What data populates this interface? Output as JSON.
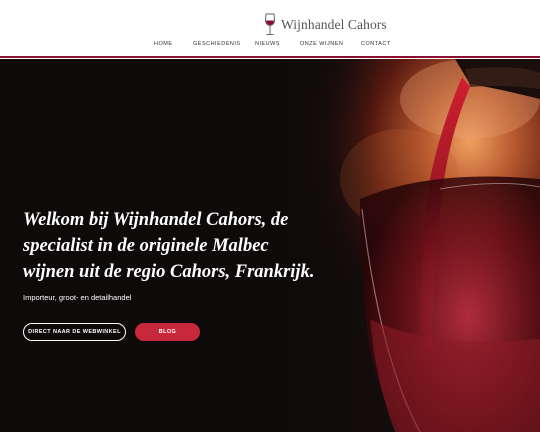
{
  "brand": {
    "name": "Wijnhandel Cahors",
    "icon": "wine-glass-icon",
    "accent": "#8a1030"
  },
  "nav": {
    "items": [
      "Home",
      "Geschiedenis",
      "Nieuws",
      "Onze wijnen",
      "Contact"
    ]
  },
  "hero": {
    "headline": "Welkom bij Wijnhandel Cahors, de specialist in de originele Malbec wijnen uit de regio Cahors, Frankrijk.",
    "subline": "Importeur, groot- en detailhandel",
    "buttons": {
      "shop": "Direct naar de webwinkel",
      "blog": "Blog"
    },
    "button_color": "#c8283c",
    "background_image": "red-wine-pouring-into-glass"
  }
}
